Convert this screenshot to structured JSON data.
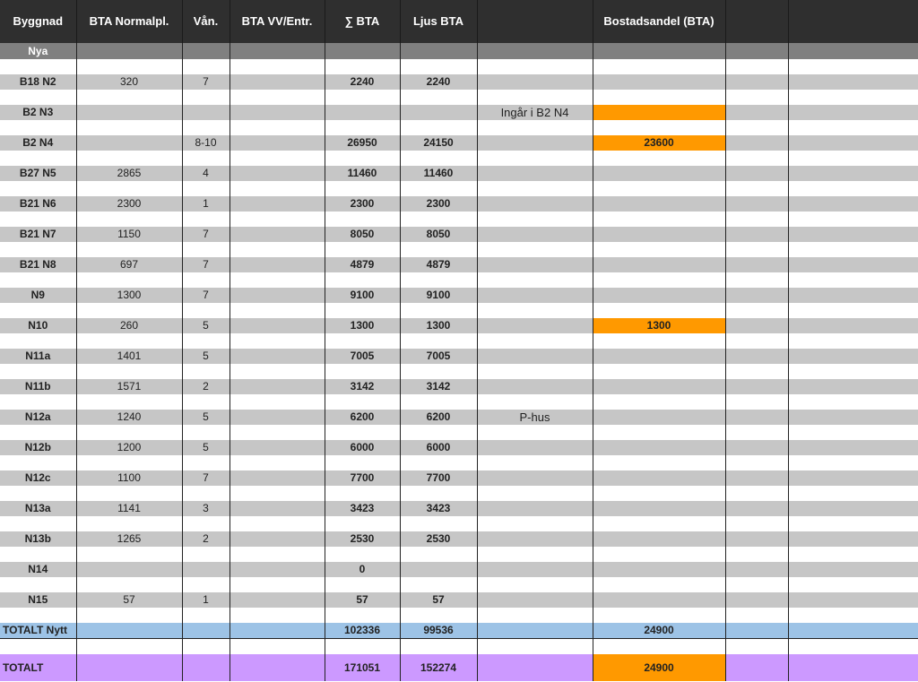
{
  "header": {
    "byggnad": "Byggnad",
    "bta_normal": "BTA Normalpl.",
    "van": "Vån.",
    "bta_vv": "BTA VV/Entr.",
    "sum_bta": "∑ BTA",
    "ljus_bta": "Ljus BTA",
    "note": "",
    "bostad": "Bostadsandel (BTA)"
  },
  "section_label": "Nya",
  "rows": [
    {
      "byggnad": "B18 N2",
      "bta_normal": "320",
      "van": "7",
      "bta_vv": "",
      "sum_bta": "2240",
      "ljus_bta": "2240",
      "note": "",
      "bostad": ""
    },
    {
      "byggnad": "B2 N3",
      "bta_normal": "",
      "van": "",
      "bta_vv": "",
      "sum_bta": "",
      "ljus_bta": "",
      "note": "Ingår i B2 N4",
      "bostad": ""
    },
    {
      "byggnad": "B2 N4",
      "bta_normal": "",
      "van": "8-10",
      "bta_vv": "",
      "sum_bta": "26950",
      "ljus_bta": "24150",
      "note": "",
      "bostad": "23600"
    },
    {
      "byggnad": "B27 N5",
      "bta_normal": "2865",
      "van": "4",
      "bta_vv": "",
      "sum_bta": "11460",
      "ljus_bta": "11460",
      "note": "",
      "bostad": ""
    },
    {
      "byggnad": "B21 N6",
      "bta_normal": "2300",
      "van": "1",
      "bta_vv": "",
      "sum_bta": "2300",
      "ljus_bta": "2300",
      "note": "",
      "bostad": ""
    },
    {
      "byggnad": "B21 N7",
      "bta_normal": "1150",
      "van": "7",
      "bta_vv": "",
      "sum_bta": "8050",
      "ljus_bta": "8050",
      "note": "",
      "bostad": ""
    },
    {
      "byggnad": "B21 N8",
      "bta_normal": "697",
      "van": "7",
      "bta_vv": "",
      "sum_bta": "4879",
      "ljus_bta": "4879",
      "note": "",
      "bostad": ""
    },
    {
      "byggnad": "N9",
      "bta_normal": "1300",
      "van": "7",
      "bta_vv": "",
      "sum_bta": "9100",
      "ljus_bta": "9100",
      "note": "",
      "bostad": ""
    },
    {
      "byggnad": "N10",
      "bta_normal": "260",
      "van": "5",
      "bta_vv": "",
      "sum_bta": "1300",
      "ljus_bta": "1300",
      "note": "",
      "bostad": "1300"
    },
    {
      "byggnad": "N11a",
      "bta_normal": "1401",
      "van": "5",
      "bta_vv": "",
      "sum_bta": "7005",
      "ljus_bta": "7005",
      "note": "",
      "bostad": ""
    },
    {
      "byggnad": "N11b",
      "bta_normal": "1571",
      "van": "2",
      "bta_vv": "",
      "sum_bta": "3142",
      "ljus_bta": "3142",
      "note": "",
      "bostad": ""
    },
    {
      "byggnad": "N12a",
      "bta_normal": "1240",
      "van": "5",
      "bta_vv": "",
      "sum_bta": "6200",
      "ljus_bta": "6200",
      "note": "P-hus",
      "bostad": ""
    },
    {
      "byggnad": "N12b",
      "bta_normal": "1200",
      "van": "5",
      "bta_vv": "",
      "sum_bta": "6000",
      "ljus_bta": "6000",
      "note": "",
      "bostad": ""
    },
    {
      "byggnad": "N12c",
      "bta_normal": "1100",
      "van": "7",
      "bta_vv": "",
      "sum_bta": "7700",
      "ljus_bta": "7700",
      "note": "",
      "bostad": ""
    },
    {
      "byggnad": "N13a",
      "bta_normal": "1141",
      "van": "3",
      "bta_vv": "",
      "sum_bta": "3423",
      "ljus_bta": "3423",
      "note": "",
      "bostad": ""
    },
    {
      "byggnad": "N13b",
      "bta_normal": "1265",
      "van": "2",
      "bta_vv": "",
      "sum_bta": "2530",
      "ljus_bta": "2530",
      "note": "",
      "bostad": ""
    },
    {
      "byggnad": "N14",
      "bta_normal": "",
      "van": "",
      "bta_vv": "",
      "sum_bta": "0",
      "ljus_bta": "",
      "note": "",
      "bostad": ""
    },
    {
      "byggnad": "N15",
      "bta_normal": "57",
      "van": "1",
      "bta_vv": "",
      "sum_bta": "57",
      "ljus_bta": "57",
      "note": "",
      "bostad": ""
    }
  ],
  "totalt_nytt": {
    "label": "TOTALT Nytt",
    "sum_bta": "102336",
    "ljus_bta": "99536",
    "bostad": "24900"
  },
  "totalt": {
    "label": "TOTALT",
    "sum_bta": "171051",
    "ljus_bta": "152274",
    "bostad": "24900"
  },
  "colors": {
    "header": "#2f2f2f",
    "section": "#808080",
    "row_fill": "#c6c6c6",
    "highlight": "#ff9900",
    "total_nytt": "#9dc3e6",
    "total": "#cc99ff"
  }
}
